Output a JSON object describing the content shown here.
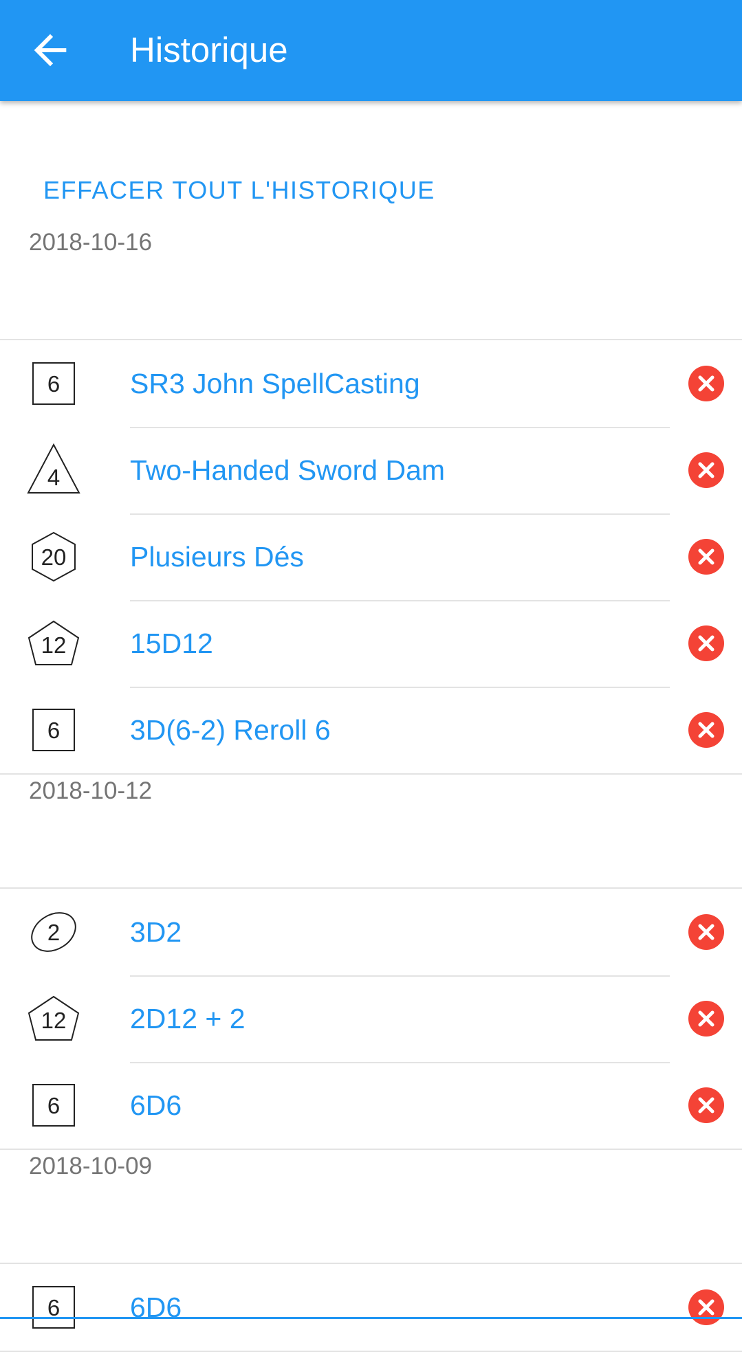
{
  "appbar": {
    "title": "Historique",
    "back_icon": "arrow-back-icon",
    "color": "#2196F3"
  },
  "clear_all_label": "EFFACER TOUT L'HISTORIQUE",
  "colors": {
    "accent": "#2196F3",
    "delete": "#F44336",
    "date": "#757575"
  },
  "groups": [
    {
      "date": "2018-10-16",
      "items": [
        {
          "die": "d6",
          "die_label": "6",
          "name": "SR3 John SpellCasting"
        },
        {
          "die": "d4",
          "die_label": "4",
          "name": "Two-Handed Sword Dam"
        },
        {
          "die": "d20",
          "die_label": "20",
          "name": "Plusieurs Dés"
        },
        {
          "die": "d12",
          "die_label": "12",
          "name": "15D12"
        },
        {
          "die": "d6",
          "die_label": "6",
          "name": "3D(6-2) Reroll 6"
        }
      ]
    },
    {
      "date": "2018-10-12",
      "items": [
        {
          "die": "d2",
          "die_label": "2",
          "name": "3D2"
        },
        {
          "die": "d12",
          "die_label": "12",
          "name": "2D12 + 2"
        },
        {
          "die": "d6",
          "die_label": "6",
          "name": "6D6"
        }
      ]
    },
    {
      "date": "2018-10-09",
      "items": [
        {
          "die": "d6",
          "die_label": "6",
          "name": "6D6"
        }
      ]
    }
  ]
}
